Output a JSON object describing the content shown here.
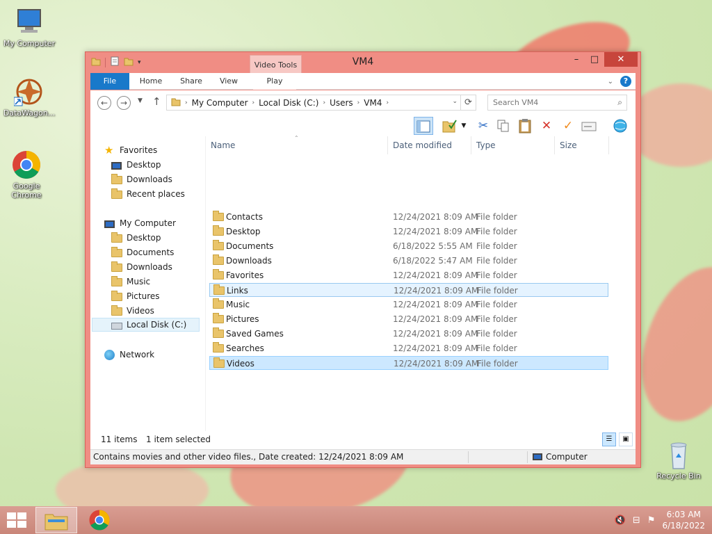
{
  "desktop": {
    "icons": [
      {
        "label": "My Computer"
      },
      {
        "label": "DataWagon..."
      },
      {
        "label": "Google Chrome"
      },
      {
        "label": "Recycle Bin"
      }
    ]
  },
  "window": {
    "title": "VM4",
    "contextual_tab_group": "Video Tools",
    "ribbon_tabs": [
      "File",
      "Home",
      "Share",
      "View",
      "Play"
    ],
    "address": {
      "crumbs": [
        "My Computer",
        "Local Disk (C:)",
        "Users",
        "VM4"
      ]
    },
    "search": {
      "placeholder": "Search VM4"
    },
    "columns": [
      "Name",
      "Date modified",
      "Type",
      "Size"
    ],
    "files": [
      {
        "name": "Contacts",
        "date": "12/24/2021 8:09 AM",
        "type": "File folder"
      },
      {
        "name": "Desktop",
        "date": "12/24/2021 8:09 AM",
        "type": "File folder"
      },
      {
        "name": "Documents",
        "date": "6/18/2022 5:55 AM",
        "type": "File folder"
      },
      {
        "name": "Downloads",
        "date": "6/18/2022 5:47 AM",
        "type": "File folder"
      },
      {
        "name": "Favorites",
        "date": "12/24/2021 8:09 AM",
        "type": "File folder"
      },
      {
        "name": "Links",
        "date": "12/24/2021 8:09 AM",
        "type": "File folder"
      },
      {
        "name": "Music",
        "date": "12/24/2021 8:09 AM",
        "type": "File folder"
      },
      {
        "name": "Pictures",
        "date": "12/24/2021 8:09 AM",
        "type": "File folder"
      },
      {
        "name": "Saved Games",
        "date": "12/24/2021 8:09 AM",
        "type": "File folder"
      },
      {
        "name": "Searches",
        "date": "12/24/2021 8:09 AM",
        "type": "File folder"
      },
      {
        "name": "Videos",
        "date": "12/24/2021 8:09 AM",
        "type": "File folder"
      }
    ],
    "nav": {
      "favorites": {
        "label": "Favorites",
        "items": [
          "Desktop",
          "Downloads",
          "Recent places"
        ]
      },
      "computer": {
        "label": "My Computer",
        "items": [
          "Desktop",
          "Documents",
          "Downloads",
          "Music",
          "Pictures",
          "Videos",
          "Local Disk (C:)"
        ]
      },
      "network": {
        "label": "Network"
      }
    },
    "status": {
      "item_count": "11 items",
      "selection": "1 item selected",
      "description": "Contains movies and other video files., Date created: 12/24/2021 8:09 AM",
      "location": "Computer"
    }
  },
  "taskbar": {
    "time": "6:03 AM",
    "date": "6/18/2022"
  }
}
